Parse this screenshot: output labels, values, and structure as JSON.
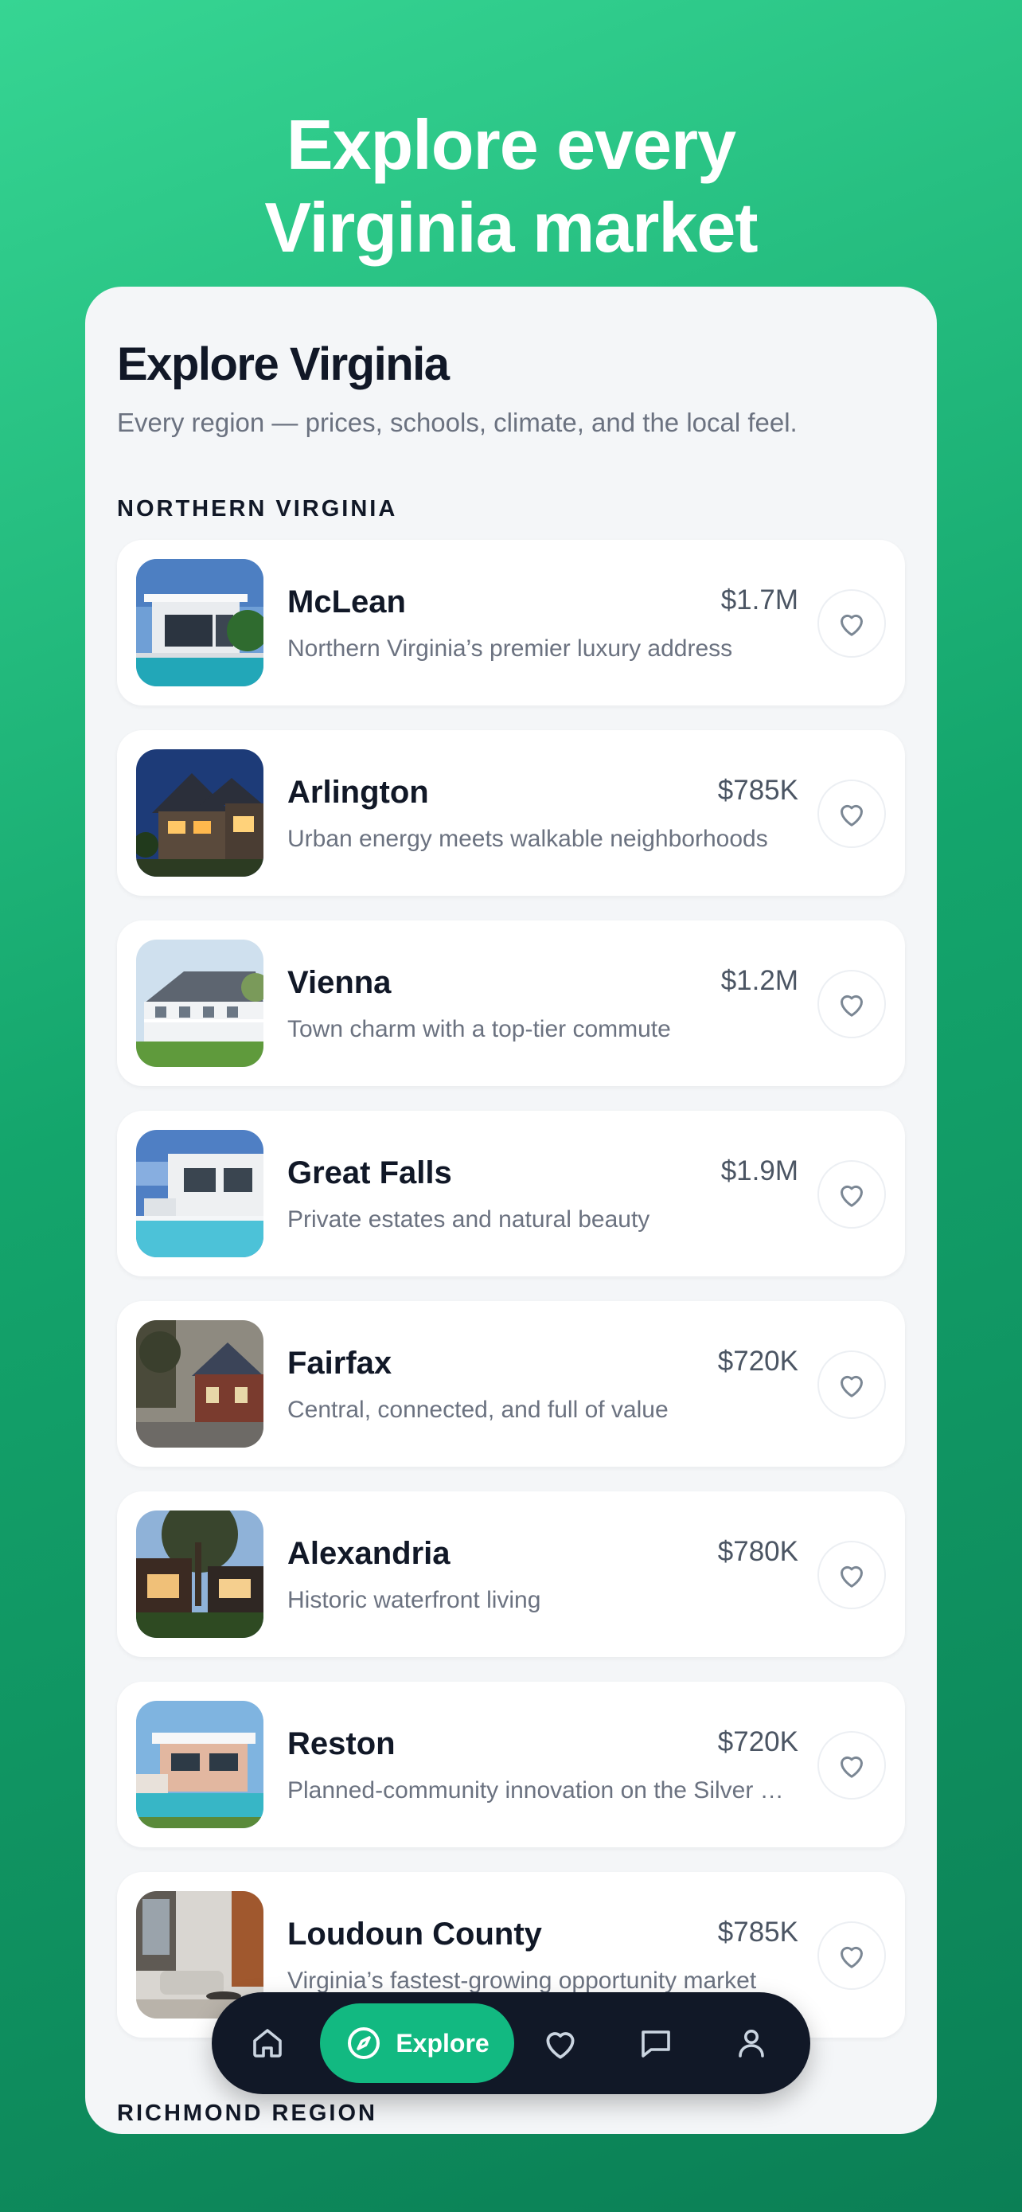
{
  "hero": {
    "line1": "Explore every",
    "line2": "Virginia market"
  },
  "page": {
    "title": "Explore Virginia",
    "subtitle": "Every region — prices, schools, climate, and the local feel."
  },
  "sections": [
    {
      "label": "NORTHERN VIRGINIA"
    },
    {
      "label": "RICHMOND REGION"
    }
  ],
  "markets": [
    {
      "name": "McLean",
      "price": "$1.7M",
      "desc": "Northern Virginia’s premier luxury address",
      "thumb": "modern-house-pool",
      "favorited": false
    },
    {
      "name": "Arlington",
      "price": "$785K",
      "desc": "Urban energy meets walkable neighborhoods",
      "thumb": "dusk-gabled-house",
      "favorited": false
    },
    {
      "name": "Vienna",
      "price": "$1.2M",
      "desc": "Town charm with a top-tier commute",
      "thumb": "white-porch-house",
      "favorited": false
    },
    {
      "name": "Great Falls",
      "price": "$1.9M",
      "desc": "Private estates and natural beauty",
      "thumb": "white-modern-villa-pool",
      "favorited": false
    },
    {
      "name": "Fairfax",
      "price": "$720K",
      "desc": "Central, connected, and full of value",
      "thumb": "brick-house-trees",
      "favorited": false
    },
    {
      "name": "Alexandria",
      "price": "$780K",
      "desc": "Historic waterfront living",
      "thumb": "modern-house-oak",
      "favorited": false
    },
    {
      "name": "Reston",
      "price": "$720K",
      "desc": "Planned-community innovation on the Silver Line",
      "thumb": "contemporary-house-pool",
      "favorited": false
    },
    {
      "name": "Loudoun County",
      "price": "$785K",
      "desc": "Virginia’s fastest-growing opportunity market",
      "thumb": "modern-interior",
      "favorited": false
    }
  ],
  "nav": {
    "items": [
      {
        "icon": "home-icon",
        "label": ""
      },
      {
        "icon": "compass-icon",
        "label": "Explore",
        "active": true
      },
      {
        "icon": "heart-icon",
        "label": ""
      },
      {
        "icon": "chat-icon",
        "label": ""
      },
      {
        "icon": "profile-icon",
        "label": ""
      }
    ]
  },
  "colors": {
    "accent": "#12b981",
    "background_gradient": [
      "#36d593",
      "#0b7f55"
    ],
    "nav_background": "#111827",
    "card_background": "#f4f6f8"
  }
}
